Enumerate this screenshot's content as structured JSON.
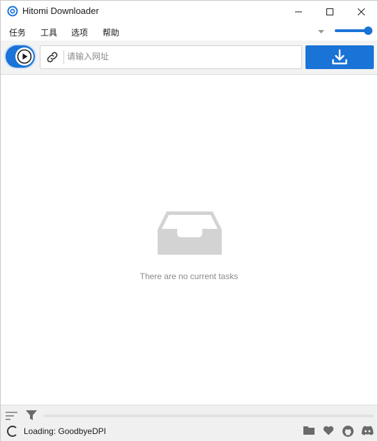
{
  "window": {
    "title": "Hitomi Downloader"
  },
  "menu": {
    "items": [
      "任务",
      "工具",
      "选项",
      "帮助"
    ]
  },
  "volume": {
    "level": 0.85
  },
  "toolbar": {
    "url_placeholder": "请输入网址"
  },
  "main": {
    "empty_message": "There are no current tasks"
  },
  "status": {
    "text": "Loading: GoodbyeDPI",
    "progress": 0
  },
  "colors": {
    "accent": "#1a73d6",
    "empty_icon": "#d3d3d3"
  },
  "icons": [
    "app-icon",
    "minimize-icon",
    "maximize-icon",
    "close-icon",
    "chevron-down-icon",
    "play-icon",
    "link-icon",
    "download-icon",
    "empty-inbox-icon",
    "sort-icon",
    "filter-icon",
    "spinner-icon",
    "folder-icon",
    "heart-icon",
    "github-icon",
    "discord-icon"
  ]
}
